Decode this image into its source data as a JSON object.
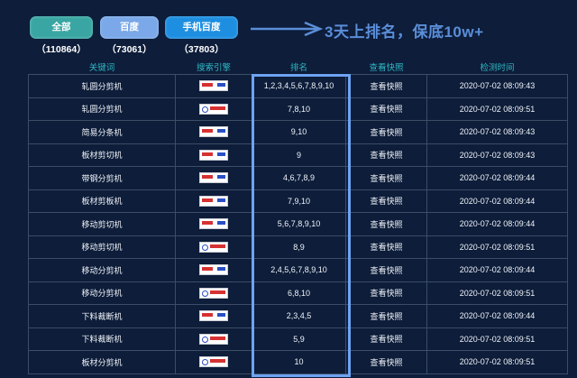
{
  "filters": {
    "all": "全部（110864）",
    "baidu": "百度（73061）",
    "mobile_baidu": "手机百度（37803）"
  },
  "slogan": "3天上排名，保底10w+",
  "table": {
    "headers": [
      "关键词",
      "搜索引擎",
      "排名",
      "查看快照",
      "检测时间"
    ],
    "rows": [
      {
        "keyword": "轧圆分剪机",
        "engine": "baidu",
        "rank": "1,2,3,4,5,6,7,8,9,10",
        "snapshot": "查看快照",
        "time": "2020-07-02 08:09:43"
      },
      {
        "keyword": "轧圆分剪机",
        "engine": "mbaidu",
        "rank": "7,8,10",
        "snapshot": "查看快照",
        "time": "2020-07-02 08:09:51"
      },
      {
        "keyword": "简易分条机",
        "engine": "baidu",
        "rank": "9,10",
        "snapshot": "查看快照",
        "time": "2020-07-02 08:09:43"
      },
      {
        "keyword": "板材剪切机",
        "engine": "baidu",
        "rank": "9",
        "snapshot": "查看快照",
        "time": "2020-07-02 08:09:43"
      },
      {
        "keyword": "带钢分剪机",
        "engine": "baidu",
        "rank": "4,6,7,8,9",
        "snapshot": "查看快照",
        "time": "2020-07-02 08:09:44"
      },
      {
        "keyword": "板材剪板机",
        "engine": "baidu",
        "rank": "7,9,10",
        "snapshot": "查看快照",
        "time": "2020-07-02 08:09:44"
      },
      {
        "keyword": "移动剪切机",
        "engine": "baidu",
        "rank": "5,6,7,8,9,10",
        "snapshot": "查看快照",
        "time": "2020-07-02 08:09:44"
      },
      {
        "keyword": "移动剪切机",
        "engine": "mbaidu",
        "rank": "8,9",
        "snapshot": "查看快照",
        "time": "2020-07-02 08:09:51"
      },
      {
        "keyword": "移动分剪机",
        "engine": "baidu",
        "rank": "2,4,5,6,7,8,9,10",
        "snapshot": "查看快照",
        "time": "2020-07-02 08:09:44"
      },
      {
        "keyword": "移动分剪机",
        "engine": "mbaidu",
        "rank": "6,8,10",
        "snapshot": "查看快照",
        "time": "2020-07-02 08:09:51"
      },
      {
        "keyword": "下料裁断机",
        "engine": "baidu",
        "rank": "2,3,4,5",
        "snapshot": "查看快照",
        "time": "2020-07-02 08:09:44"
      },
      {
        "keyword": "下料裁断机",
        "engine": "mbaidu",
        "rank": "5,9",
        "snapshot": "查看快照",
        "time": "2020-07-02 08:09:51"
      },
      {
        "keyword": "板材分剪机",
        "engine": "mbaidu",
        "rank": "10",
        "snapshot": "查看快照",
        "time": "2020-07-02 08:09:51"
      }
    ]
  },
  "colors": {
    "background": "#0d1d3a",
    "header_text": "#2fb7c3",
    "rank_highlight": "#6ea3f2",
    "slogan": "#5b8ed8"
  },
  "icons": {
    "arrow": "right-arrow-icon",
    "baidu_logo": "baidu-logo-icon",
    "mobile_baidu_logo": "mobile-baidu-logo-icon"
  }
}
